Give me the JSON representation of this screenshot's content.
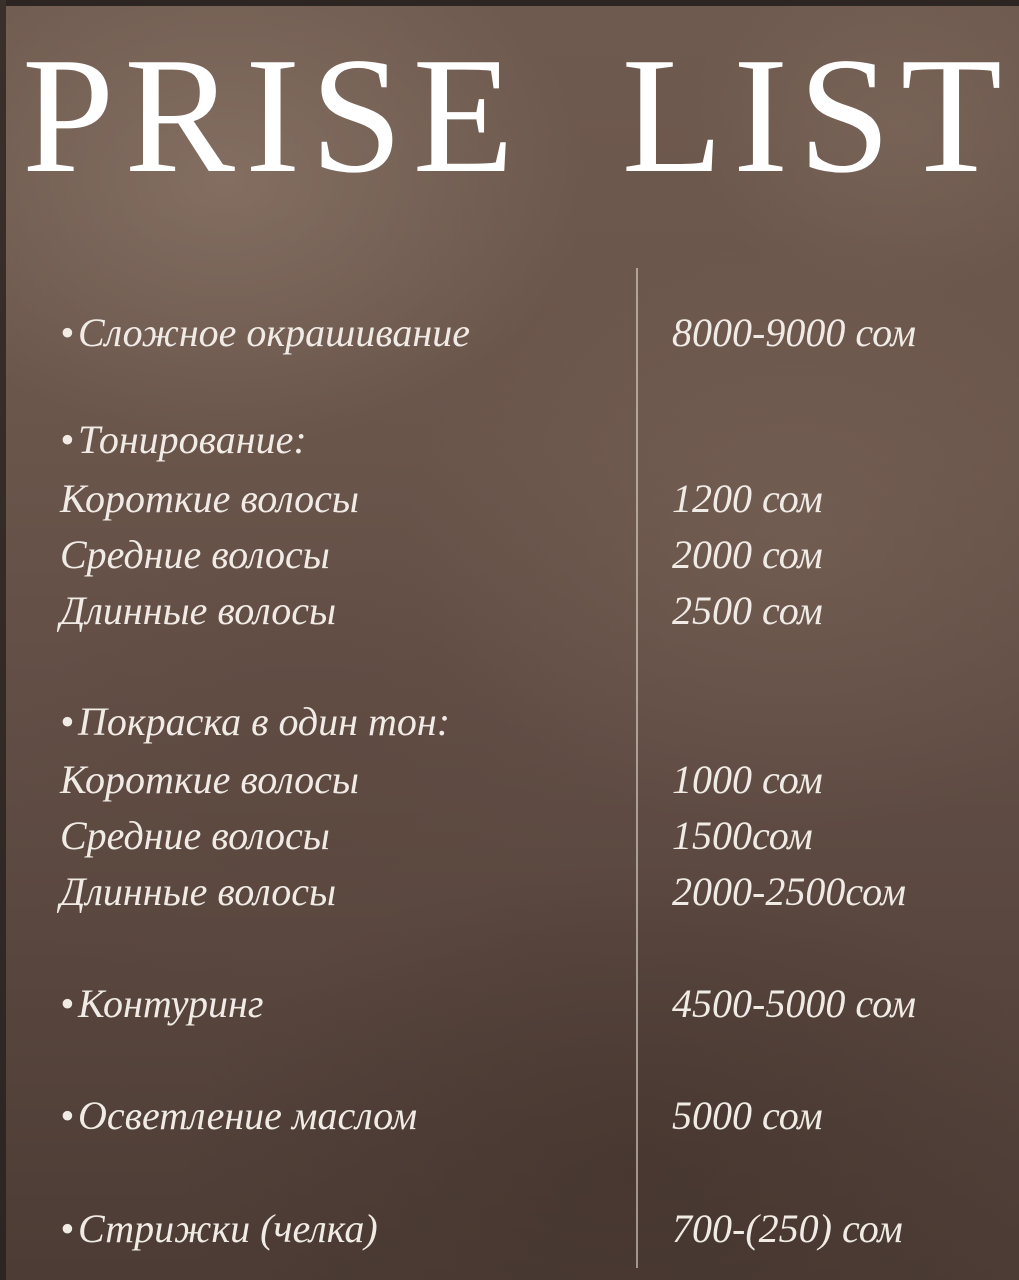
{
  "title": {
    "words": [
      "PRISE",
      "LIST"
    ]
  },
  "items": [
    {
      "label": "Сложное окрашивание",
      "price": "8000-9000 сом"
    },
    {
      "label": "Тонирование:"
    },
    {
      "label": "Короткие волосы",
      "price": "1200 сом"
    },
    {
      "label": "Средние волосы",
      "price": "2000 сом"
    },
    {
      "label": "Длинные волосы",
      "price": "2500 сом"
    },
    {
      "label": "Покраска в один тон:"
    },
    {
      "label": "Короткие волосы",
      "price": "1000 сом"
    },
    {
      "label": "Средние волосы",
      "price": "1500сом"
    },
    {
      "label": "Длинные волосы",
      "price": "2000-2500сом"
    },
    {
      "label": "Контуринг",
      "price": "4500-5000 сом"
    },
    {
      "label": "Осветление маслом",
      "price": "5000 сом"
    },
    {
      "label": "Стрижки (челка)",
      "price": "700-(250) сом"
    }
  ],
  "bullet": "•",
  "colors": {
    "background": "#6a554b",
    "text": "#f1ebe6",
    "title": "#ffffff"
  }
}
